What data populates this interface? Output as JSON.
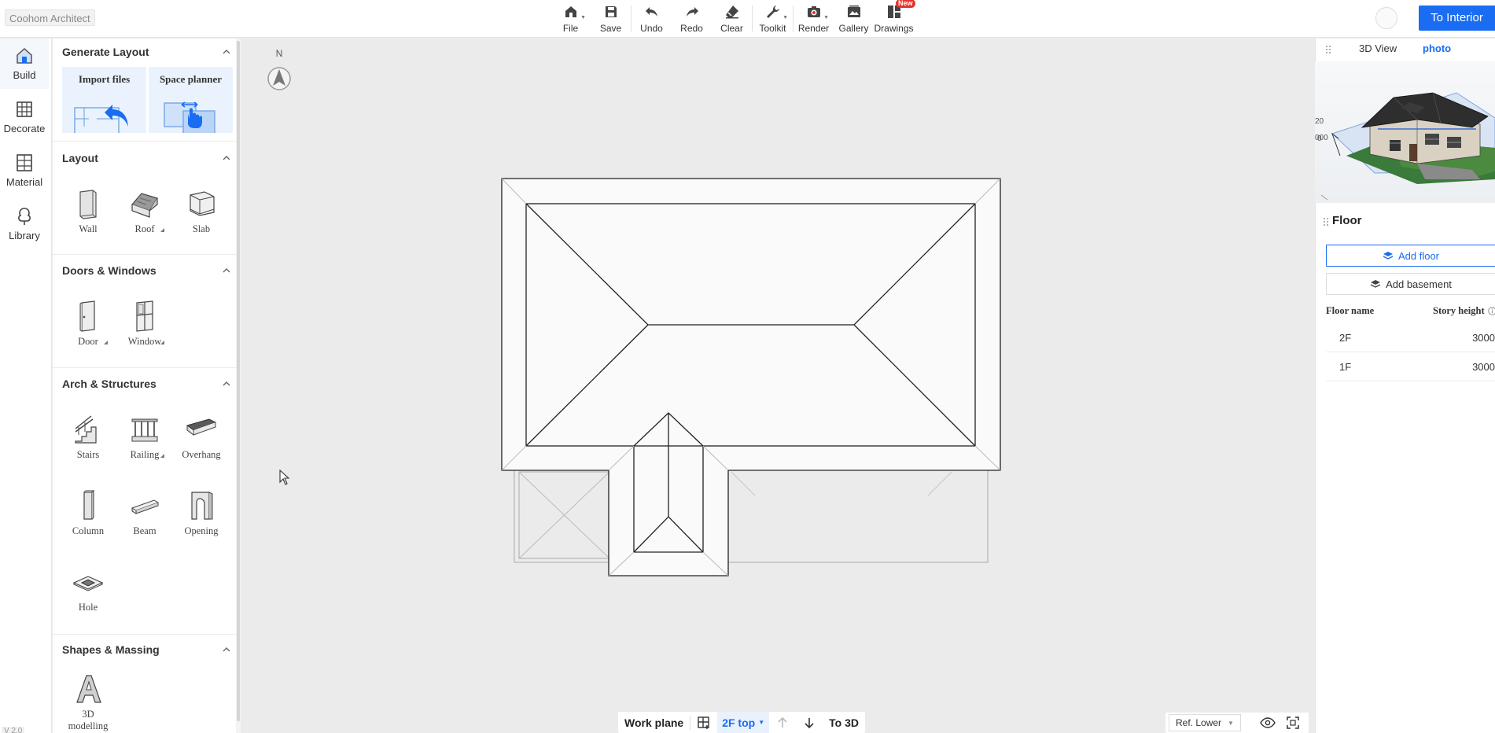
{
  "app": {
    "brand": "Coohom Architect",
    "version": "V 2.0"
  },
  "toolbar": {
    "file": "File",
    "save": "Save",
    "undo": "Undo",
    "redo": "Redo",
    "clear": "Clear",
    "toolkit": "Toolkit",
    "render": "Render",
    "gallery": "Gallery",
    "drawings": "Drawings",
    "new_badge": "New"
  },
  "header": {
    "to_interior": "To Interior"
  },
  "leftnav": {
    "build": "Build",
    "decorate": "Decorate",
    "material": "Material",
    "library": "Library"
  },
  "panel": {
    "generate_layout": {
      "title": "Generate Layout",
      "import_files": "Import files",
      "space_planner": "Space planner"
    },
    "layout": {
      "title": "Layout",
      "wall": "Wall",
      "roof": "Roof",
      "slab": "Slab"
    },
    "doors_windows": {
      "title": "Doors & Windows",
      "door": "Door",
      "window": "Window"
    },
    "arch": {
      "title": "Arch & Structures",
      "stairs": "Stairs",
      "railing": "Railing",
      "overhang": "Overhang",
      "column": "Column",
      "beam": "Beam",
      "opening": "Opening",
      "hole": "Hole"
    },
    "shapes": {
      "title": "Shapes & Massing",
      "modelling_1": "3D",
      "modelling_2": "modelling"
    }
  },
  "canvas": {
    "north": "N"
  },
  "bottombar": {
    "work_plane": "Work plane",
    "level": "2F top",
    "to_3d": "To 3D"
  },
  "rightbar": {
    "ref": "Ref. Lower"
  },
  "rpanel": {
    "tab_3d": "3D View",
    "tab_photo": "photo",
    "preview_labels": [
      "20",
      "0",
      "000"
    ],
    "floor": {
      "title": "Floor",
      "add_floor": "Add floor",
      "add_basement": "Add basement",
      "col_name": "Floor name",
      "col_height": "Story height",
      "rows": [
        {
          "name": "2F",
          "height": "3000"
        },
        {
          "name": "1F",
          "height": "3000"
        }
      ]
    }
  },
  "colors": {
    "accent": "#1a6cf2",
    "badge": "#e8322c"
  }
}
